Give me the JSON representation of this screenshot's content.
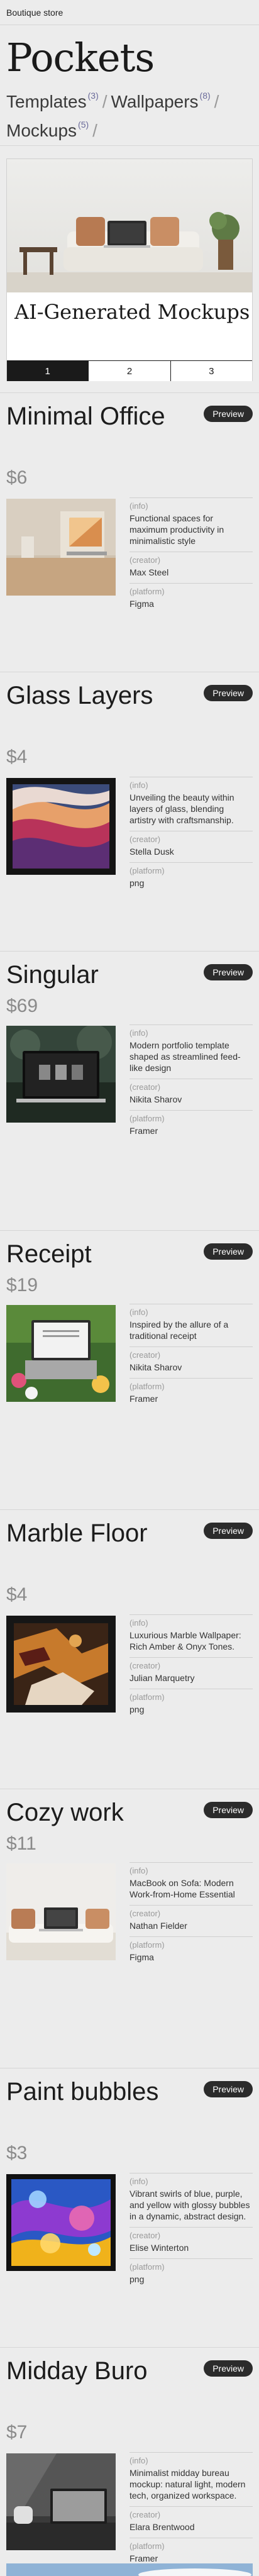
{
  "store": {
    "name": "Boutique store"
  },
  "brand": {
    "title": "Pockets",
    "nav": [
      {
        "label": "Templates",
        "count": "(3)"
      },
      {
        "label": "Wallpapers",
        "count": "(8)"
      },
      {
        "label": "Mockups",
        "count": "(5)"
      }
    ],
    "separator": "/"
  },
  "hero": {
    "title": "AI-Generated Mockups",
    "pages": [
      "1",
      "2",
      "3"
    ],
    "active_page": "1"
  },
  "labels": {
    "info": "(info)",
    "creator": "(creator)",
    "platform": "(platform)",
    "preview": "Preview"
  },
  "products": [
    {
      "title": "Minimal Office",
      "price": "$6",
      "info": "Functional spaces for maximum productivity in minimalistic style",
      "creator": "Max Steel",
      "platform": "Figma",
      "thumb_icon": "office-mockup-image"
    },
    {
      "title": "Glass Layers",
      "price": "$4",
      "info": "Unveiling the beauty within layers of glass, blending artistry with craftsmanship.",
      "creator": "Stella Dusk",
      "platform": "png",
      "thumb_icon": "glass-layers-image"
    },
    {
      "title": "Singular",
      "price": "$69",
      "info": "Modern portfolio template shaped as streamlined feed-like design",
      "creator": "Nikita Sharov",
      "platform": "Framer",
      "thumb_icon": "laptop-forest-image"
    },
    {
      "title": "Receipt",
      "price": "$19",
      "info": "Inspired by the allure of a traditional receipt",
      "creator": "Nikita Sharov",
      "platform": "Framer",
      "thumb_icon": "laptop-flowers-image"
    },
    {
      "title": "Marble Floor",
      "price": "$4",
      "info": "Luxurious Marble Wallpaper: Rich Amber & Onyx Tones.",
      "creator": "Julian Marquetry",
      "platform": "png",
      "thumb_icon": "marble-image"
    },
    {
      "title": "Cozy work",
      "price": "$11",
      "info": "MacBook on Sofa: Modern Work-from-Home Essential",
      "creator": "Nathan Fielder",
      "platform": "Figma",
      "thumb_icon": "laptop-sofa-image"
    },
    {
      "title": "Paint bubbles",
      "price": "$3",
      "info": "Vibrant swirls of blue, purple, and yellow with glossy bubbles in a dynamic, abstract design.",
      "creator": "Elise Winterton",
      "platform": "png",
      "thumb_icon": "paint-bubbles-image"
    },
    {
      "title": "Midday Buro",
      "price": "$7",
      "info": "Minimalist midday bureau mockup: natural light, modern tech, organized workspace.",
      "creator": "Elara Brentwood",
      "platform": "Framer",
      "thumb_icon": "desk-mockup-image"
    }
  ]
}
